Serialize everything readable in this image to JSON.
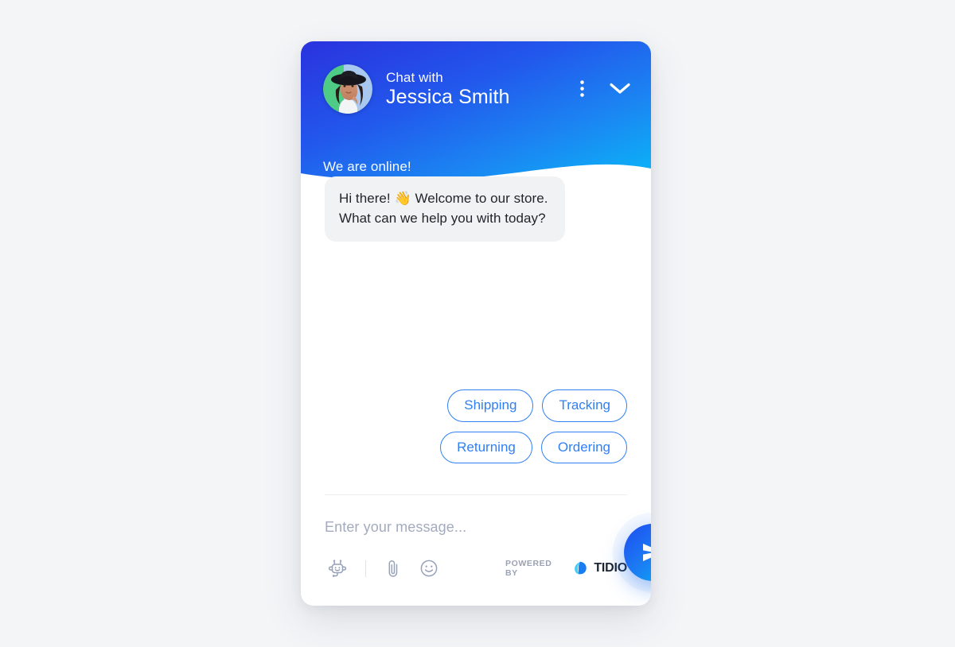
{
  "widget": {
    "header": {
      "avatar_name": "agent-avatar-photo",
      "chat_with_label": "Chat with",
      "agent_name": "Jessica Smith",
      "menu_icon": "kebab-menu-icon",
      "minimize_icon": "chevron-down-icon",
      "status_text": "We are online!",
      "gradient_start": "#2a32de",
      "gradient_end": "#11aaf5"
    },
    "conversation": {
      "messages": [
        {
          "sender": "agent",
          "text": "Hi there! 👋 Welcome to our store. What can we help you with today?",
          "background": "#f1f2f4"
        }
      ],
      "quick_replies": [
        {
          "label": "Shipping"
        },
        {
          "label": "Tracking"
        },
        {
          "label": "Returning"
        },
        {
          "label": "Ordering"
        }
      ],
      "quick_reply_color": "#2f7ff5"
    },
    "composer": {
      "input_value": "",
      "input_placeholder": "Enter your message...",
      "tools": [
        {
          "name": "chatbot-icon"
        },
        {
          "name": "attachment-icon"
        },
        {
          "name": "emoji-icon"
        }
      ],
      "powered_by_label": "POWERED BY",
      "brand_name": "TIDIO",
      "send_icon": "send-arrow-icon",
      "send_color": "#1b7ef3"
    }
  },
  "page": {
    "background": "#f4f5f7"
  }
}
